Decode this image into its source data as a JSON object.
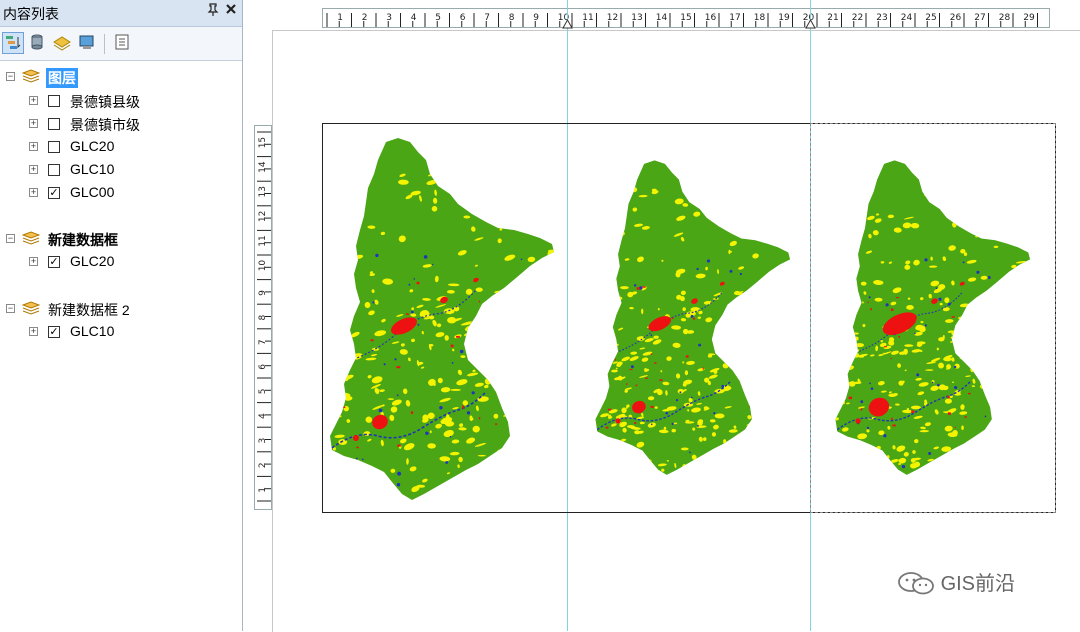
{
  "toc": {
    "title": "内容列表",
    "pin_glyph": "ᵖ",
    "close_glyph": "✕",
    "tools": [
      "list-by-drawing-order-icon",
      "list-by-source-icon",
      "list-by-visibility-icon",
      "list-by-selection-icon",
      "options-icon"
    ],
    "groups": [
      {
        "name": "图层",
        "highlighted": true,
        "layers": [
          {
            "name": "景德镇县级",
            "checked": false
          },
          {
            "name": "景德镇市级",
            "checked": false
          },
          {
            "name": "GLC20",
            "checked": false
          },
          {
            "name": "GLC10",
            "checked": false
          },
          {
            "name": "GLC00",
            "checked": true
          }
        ]
      },
      {
        "name": "新建数据框",
        "highlighted": false,
        "layers": [
          {
            "name": "GLC20",
            "checked": true
          }
        ]
      },
      {
        "name": "新建数据框 2",
        "highlighted": false,
        "layers": [
          {
            "name": "GLC10",
            "checked": true
          }
        ]
      }
    ]
  },
  "rulers": {
    "horizontal": [
      "1",
      "2",
      "3",
      "4",
      "5",
      "6",
      "7",
      "8",
      "9",
      "10",
      "11",
      "12",
      "13",
      "14",
      "15",
      "16",
      "17",
      "18",
      "19",
      "20",
      "21",
      "22",
      "23",
      "24",
      "25",
      "26",
      "27",
      "28",
      "29"
    ],
    "vertical": [
      "1",
      "2",
      "3",
      "4",
      "5",
      "6",
      "7",
      "8",
      "9",
      "10",
      "11",
      "12",
      "13",
      "14",
      "15"
    ]
  },
  "watermark": {
    "text": "GIS前沿"
  },
  "colors": {
    "forest": "#4aa615",
    "cropland": "#f4f400",
    "urban": "#ee1111",
    "water": "#2233bb",
    "toc_header": "#d9e4f2",
    "selection": "#3399ff",
    "guide": "#7fd6e0"
  }
}
